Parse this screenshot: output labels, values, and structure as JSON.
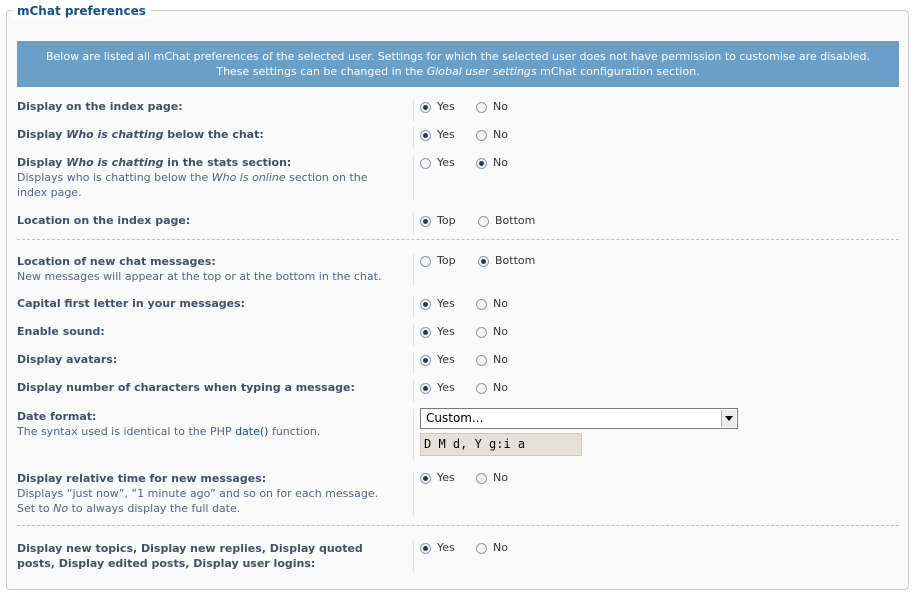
{
  "legend": "mChat preferences",
  "notice": {
    "line1": "Below are listed all mChat preferences of the selected user. Settings for which the selected user does not have permission to customise are disabled.",
    "line2_pre": "These settings can be changed in the ",
    "line2_em": "Global user settings",
    "line2_post": " mChat configuration section."
  },
  "rows": [
    {
      "pre": "Display on the index page:",
      "em": "",
      "post": "",
      "desc": "",
      "options": [
        "Yes",
        "No"
      ],
      "selected": 0
    },
    {
      "pre": "Display ",
      "em": "Who is chatting",
      "post": " below the chat:",
      "desc": "",
      "options": [
        "Yes",
        "No"
      ],
      "selected": 0
    },
    {
      "pre": "Display ",
      "em": "Who is chatting",
      "post": " in the stats section:",
      "desc_pre": "Displays who is chatting below the ",
      "desc_em": "Who is online",
      "desc_post": " section on the",
      "desc_line2": "index page.",
      "options": [
        "Yes",
        "No"
      ],
      "selected": 1
    },
    {
      "pre": "Location on the index page:",
      "options": [
        "Top",
        "Bottom"
      ],
      "selected": 0
    },
    {
      "pre": "Location of new chat messages:",
      "desc": "New messages will appear at the top or at the bottom in the chat.",
      "options": [
        "Top",
        "Bottom"
      ],
      "selected": 1
    },
    {
      "pre": "Capital first letter in your messages:",
      "options": [
        "Yes",
        "No"
      ],
      "selected": 0
    },
    {
      "pre": "Enable sound:",
      "options": [
        "Yes",
        "No"
      ],
      "selected": 0
    },
    {
      "pre": "Display avatars:",
      "options": [
        "Yes",
        "No"
      ],
      "selected": 0
    },
    {
      "pre": "Display number of characters when typing a message:",
      "options": [
        "Yes",
        "No"
      ],
      "selected": 0
    },
    {
      "pre": "Date format:",
      "desc_pre": "The syntax used is identical to the PHP ",
      "desc_link": "date()",
      "desc_post": " function."
    },
    {
      "pre": "Display relative time for new messages:",
      "desc": "Displays “just now”, “1 minute ago” and so on for each message.",
      "desc_pre2": "Set to ",
      "desc_em2": "No",
      "desc_post2": " to always display the full date.",
      "options": [
        "Yes",
        "No"
      ],
      "selected": 0
    },
    {
      "pre": "Display new topics, Display new replies, Display quoted",
      "pre2": "posts, Display edited posts, Display user logins:",
      "options": [
        "Yes",
        "No"
      ],
      "selected": 0
    }
  ],
  "date_format": {
    "select_value": "Custom...",
    "custom_value": "D M d, Y g:i a"
  },
  "colors": {
    "accent": "#115098",
    "notice_bg": "#6aa0c8"
  }
}
